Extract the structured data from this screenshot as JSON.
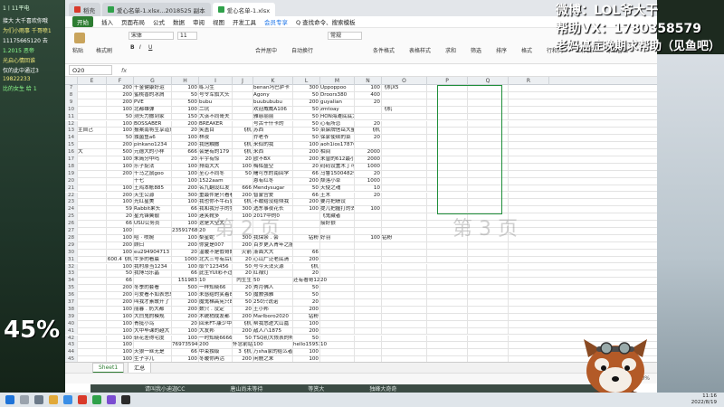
{
  "stream": {
    "left_lines": [
      "1丨11平电",
      "接大 大千喜欢你哦",
      "为们小雨事 千哥喷1",
      "11175665120 去",
      "1.2015 恶帝",
      "光启心情回谁",
      "仅的此中通过3",
      "19822233",
      "比的女生 给 1"
    ],
    "percent": "45%",
    "overlay_line1": "微博：LOL爷大干",
    "overlay_line2": "帮助VX：1780358579",
    "overlay_line3": "老妈癌症晚期求帮助（见鱼吧）",
    "banner": [
      "请叫我小迪迦CC",
      "唐山尚未等待",
      "等赏大",
      "独峰大奇奇"
    ]
  },
  "window": {
    "tabs": [
      {
        "label": "稻壳",
        "icon": "red"
      },
      {
        "label": "爱心名单-1.xlsx...2018525 副本",
        "icon": "green"
      },
      {
        "label": "爱心名单-1.xlsx",
        "icon": "green"
      }
    ],
    "menu": [
      "开始",
      "插入",
      "页面布局",
      "公式",
      "数据",
      "审阅",
      "视图",
      "开发工具",
      "会员专享",
      "Q 查找命令、搜索模板"
    ],
    "ribbon": {
      "font_name": "宋体",
      "font_size": "11",
      "buttons": [
        "粘贴",
        "格式刷",
        "合并居中",
        "自动换行",
        "常规",
        "条件格式",
        "表格样式",
        "求和",
        "筛选",
        "排序",
        "格式",
        "行和列",
        "工作表",
        "冻结窗格"
      ]
    },
    "namebox": "O20",
    "fx": "fx",
    "columns": [
      "",
      "E",
      "F",
      "G",
      "H",
      "I",
      "J",
      "K",
      "L",
      "M",
      "N",
      "O",
      "P",
      "Q",
      "R"
    ],
    "rows": [
      [
        "7",
        "",
        "200",
        "千金健康好运",
        "100",
        "练习生",
        "",
        "benan冯巴萨卡",
        "300",
        "Uppoppoo",
        "100",
        "飞机X5",
        "",
        ""
      ],
      [
        "8",
        "",
        "200",
        "蜜桃香的冰屑",
        "50",
        "号令军旗大头",
        "",
        "Agony",
        "50",
        "Droors380",
        "400",
        "",
        "",
        ""
      ],
      [
        "9",
        "",
        "200",
        "PVE",
        "500",
        "bubu",
        "",
        "buubububu",
        "200",
        "guyalian",
        "20",
        "",
        "",
        ""
      ],
      [
        "10",
        "",
        "100",
        "北都雄弹",
        "100",
        "二坑",
        "",
        "欢迎威威A106",
        "50",
        "zmtoay",
        "",
        "飞机",
        "",
        ""
      ],
      [
        "11",
        "",
        "50",
        "测头力撒到家",
        "150",
        "大该不同哥夫",
        "",
        "雅慈丽丽",
        "50",
        "HON海滩底底太大",
        "",
        "",
        "",
        ""
      ],
      [
        "12",
        "",
        "100",
        "BOSSABER",
        "200",
        "BREAKER",
        "",
        "号古干什卡的",
        "50",
        "心有所恋",
        "20",
        "",
        "",
        ""
      ],
      [
        "13",
        "主自己",
        "100",
        "报案南将生享道意",
        "20",
        "笑盖目",
        "飞机",
        "苏西",
        "50",
        "菜屎牌信岳大量",
        "飞机",
        "",
        "",
        ""
      ],
      [
        "14",
        "",
        "50",
        "独菌鱼a6",
        "100",
        "林夜",
        "",
        "乔老爷",
        "50",
        "保家使续的菜",
        "20",
        "",
        "",
        ""
      ],
      [
        "15",
        "",
        "200",
        "pinkano1234",
        "200",
        "我信触撒",
        "飞机",
        "来似的我",
        "100",
        "aoh1ios17876921B2",
        "",
        "",
        "",
        ""
      ],
      [
        "16",
        "大",
        "500",
        "元德大的小样",
        "666",
        "会是有的179",
        "飞机",
        "米西",
        "200",
        "相间",
        "2000",
        "",
        "",
        ""
      ],
      [
        "17",
        "",
        "100",
        "朱简分中吗",
        "20",
        "平宇有惊",
        "20",
        "欧不BX",
        "200",
        "未曾的612最小王子",
        "2000",
        "",
        "",
        ""
      ],
      [
        "18",
        "",
        "100",
        "乐子捉法",
        "100",
        "排南大大",
        "100",
        "梅佑盛空",
        "20",
        "码码设置木丁可帮",
        "1000",
        "",
        "",
        ""
      ],
      [
        "19",
        "",
        "200",
        "千马之鼠goo",
        "100",
        "至心不同冬",
        "50",
        "曙可东的南回学",
        "66",
        "马鲁15004829179",
        "20",
        "",
        "",
        ""
      ],
      [
        "20",
        "",
        "",
        "十七",
        "100",
        "1522aam",
        "",
        "恩有红冬",
        "200",
        "颓落小草",
        "1000",
        "",
        "",
        ""
      ],
      [
        "21",
        "",
        "100",
        "王鸡本帐885",
        "200",
        "名九翻设红发",
        "666",
        "Mendysugar",
        "50",
        "天使之魂",
        "10",
        "",
        "",
        ""
      ],
      [
        "22",
        "",
        "200",
        "天生公源",
        "300",
        "重最件是只看看看",
        "200",
        "智蒙宫爱",
        "66",
        "王木",
        "20",
        "",
        "",
        ""
      ],
      [
        "23",
        "",
        "100",
        "光红星美",
        "100",
        "我也你不牛石更是",
        "飞机",
        "不敢给没给倾我",
        "200",
        "要月把绩设",
        "",
        "",
        "",
        ""
      ],
      [
        "24",
        "",
        "59",
        "Rabbit果头",
        "66",
        "我和我分手的梦想",
        "300",
        "选东事夜花长",
        "100",
        "提几把握打的去武好",
        "100",
        "",
        "",
        ""
      ],
      [
        "25",
        "",
        "20",
        "星光锋簧靓",
        "100",
        "迷笑靴多",
        "100",
        "2017中的0",
        "",
        "飞鬼藏者",
        "",
        "",
        "",
        ""
      ],
      [
        "26",
        "",
        "66",
        "USU公务员",
        "100",
        "这是大空大",
        "",
        "",
        "",
        "接好狼",
        "",
        "",
        "",
        ""
      ],
      [
        "27",
        "",
        "100",
        "",
        "2359176801",
        "20",
        "",
        "",
        "",
        "",
        "",
        "",
        "",
        ""
      ],
      [
        "28",
        "",
        "100",
        "哈 · 喷婉",
        "100",
        "梨星蛇",
        "300",
        "我保余 . 会",
        "钻粉",
        "好羽",
        "100",
        "钻粉",
        "",
        ""
      ],
      [
        "29",
        "",
        "200",
        "顾曰",
        "200",
        "你夏是007",
        "200",
        "百岁更入青年之服",
        "",
        "",
        "",
        "",
        "",
        ""
      ],
      [
        "30",
        "",
        "100",
        "eu294904713",
        "20",
        "温暖不是假哥的",
        "火箭",
        "渐面大大",
        "66",
        "",
        "",
        "",
        "",
        ""
      ],
      [
        "31",
        "",
        "600.4飞机",
        "牛多的看晨",
        "1000",
        "北大三号有后球111",
        "20",
        "心山广泛老底清",
        "200",
        "",
        "",
        "",
        "",
        ""
      ],
      [
        "32",
        "",
        "100",
        "我村原当1234",
        "100",
        "取个123456",
        "50",
        "号今天法火源",
        "飞机",
        "",
        "",
        "",
        "",
        ""
      ],
      [
        "33",
        "",
        "50",
        "我博乌乐晶",
        "66",
        "此生YUI彩不过相速",
        "20",
        "红禄灯",
        "20",
        "",
        "",
        "",
        "",
        ""
      ],
      [
        "34",
        "",
        "66",
        "",
        "151983",
        "10",
        "内生生",
        "50",
        "还有著哥1232123",
        "20",
        "",
        "",
        "",
        ""
      ],
      [
        "35",
        "",
        "200",
        "冬季的套看",
        "500",
        "一样知晓66",
        "20",
        "秀月佛人",
        "50",
        "",
        "",
        "",
        "",
        ""
      ],
      [
        "36",
        "",
        "200",
        "可爱看不如表思思H",
        "100",
        "未感给的笑着821",
        "50",
        "魔教强雅",
        "50",
        "",
        "",
        "",
        "",
        ""
      ],
      [
        "37",
        "",
        "200",
        "叫我才素故开了",
        "200",
        "魔鬼梯高宪只8",
        "50",
        "250只说诺",
        "20",
        "",
        "",
        "",
        "",
        ""
      ],
      [
        "38",
        "",
        "100",
        "丽暮 . 奶大都",
        "200",
        "数只 . 没定",
        "20",
        "王小邦",
        "200",
        "",
        "",
        "",
        "",
        ""
      ],
      [
        "39",
        "",
        "100",
        "大白鬼的模规",
        "200",
        "木统稍成友都",
        "200",
        "Marlboro2020",
        "钻粉",
        "",
        "",
        "",
        "",
        ""
      ],
      [
        "40",
        "",
        "100",
        "青挺小鸟",
        "20",
        "回来FT-康少中心",
        "飞机",
        "帮我悉迹大山嘉",
        "100",
        "",
        "",
        "",
        "",
        ""
      ],
      [
        "41",
        "",
        "100",
        "大中毕课的越大",
        "100",
        "大友邦",
        "200",
        "敌人八1875",
        "200",
        "",
        "",
        "",
        "",
        ""
      ],
      [
        "42",
        "",
        "100",
        "斩花差得宅度",
        "100",
        "一时知晓666666",
        "50",
        "TSQ初大恢表的鸭船",
        "50",
        "",
        "",
        "",
        "",
        ""
      ],
      [
        "43",
        "",
        "100",
        "",
        "769735940",
        "200",
        "怀念前站的我们",
        "100",
        "hello15953",
        "10",
        "",
        "",
        "",
        ""
      ],
      [
        "44",
        "",
        "100",
        "天狼一丝无是",
        "66",
        "中束独级",
        "3飞机",
        "万sha家的给么者",
        "100",
        "",
        "",
        "",
        "",
        ""
      ],
      [
        "45",
        "",
        "100",
        "生子字儿",
        "100",
        "冬暖你再活",
        "200",
        "闲鹿之末",
        "100",
        "",
        "",
        "",
        "",
        ""
      ],
      [
        "46",
        "",
        "200",
        "未作过课",
        "100",
        "天生爱吃",
        "50",
        "来QQ . 是糊?",
        "100",
        "",
        "",
        "",
        "",
        ""
      ]
    ],
    "watermark_left": "第 2 页",
    "watermark_right": "第 3 页",
    "sheet_tabs": [
      "Sheet1",
      "汇总"
    ],
    "status": [
      "□",
      "⊞",
      "100%"
    ]
  },
  "taskbar": {
    "time": "11:16",
    "date": "2022/8/19"
  }
}
